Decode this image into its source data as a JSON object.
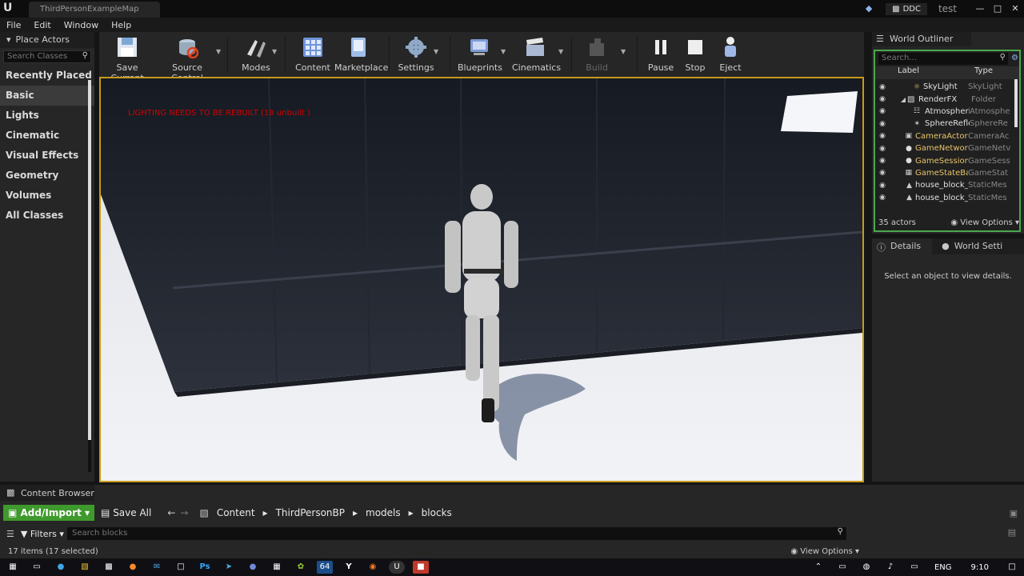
{
  "window": {
    "map_tab": "ThirdPersonExampleMap",
    "ddc_label": "DDC",
    "user_label": "test"
  },
  "menu": [
    "File",
    "Edit",
    "Window",
    "Help"
  ],
  "place_actors": {
    "title": "Place Actors",
    "search_placeholder": "Search Classes",
    "categories": [
      "Recently Placed",
      "Basic",
      "Lights",
      "Cinematic",
      "Visual Effects",
      "Geometry",
      "Volumes",
      "All Classes"
    ],
    "active_category": "Basic"
  },
  "toolbar": {
    "save_current": "Save Current",
    "source_control": "Source Control",
    "modes": "Modes",
    "content": "Content",
    "marketplace": "Marketplace",
    "settings": "Settings",
    "blueprints": "Blueprints",
    "cinematics": "Cinematics",
    "build": "Build",
    "pause": "Pause",
    "stop": "Stop",
    "eject": "Eject"
  },
  "viewport": {
    "lighting_warning": "LIGHTING NEEDS TO BE REBUILT (18 unbuilt )"
  },
  "world_outliner": {
    "title": "World Outliner",
    "search_placeholder": "Search...",
    "col_label": "Label",
    "col_type": "Type",
    "rows": [
      {
        "label": "SkyLight",
        "type": "SkyLight"
      },
      {
        "label": "RenderFX",
        "type": "Folder"
      },
      {
        "label": "Atmospheric",
        "type": "Atmosphe"
      },
      {
        "label": "SphereRefle",
        "type": "SphereRe"
      },
      {
        "label": "CameraActor",
        "type": "CameraAc"
      },
      {
        "label": "GameNetworkI",
        "type": "GameNetv"
      },
      {
        "label": "GameSession",
        "type": "GameSess"
      },
      {
        "label": "GameStateBas",
        "type": "GameStat"
      },
      {
        "label": "house_block_c",
        "type": "StaticMes"
      },
      {
        "label": "house_block_c",
        "type": "StaticMes"
      }
    ],
    "actor_count": "35 actors",
    "view_options": "View Options"
  },
  "details": {
    "tab_details": "Details",
    "tab_world_settings": "World Setti",
    "empty_message": "Select an object to view details."
  },
  "content_browser": {
    "title": "Content Browser",
    "add_import": "Add/Import",
    "save_all": "Save All",
    "path": [
      "Content",
      "ThirdPersonBP",
      "models",
      "blocks"
    ],
    "filters": "Filters",
    "search_placeholder": "Search blocks",
    "status": "17 items (17 selected)",
    "view_options": "View Options"
  },
  "taskbar": {
    "language": "ENG",
    "time": "9:10"
  }
}
